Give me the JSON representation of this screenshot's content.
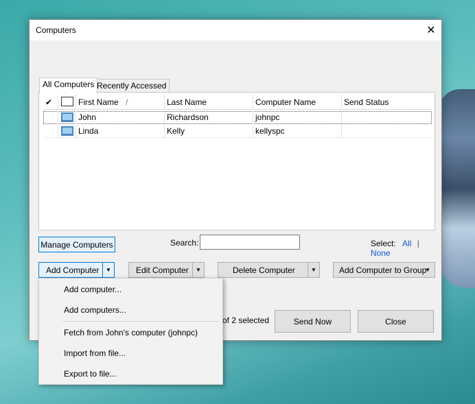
{
  "dialog": {
    "title": "Computers"
  },
  "tabs": [
    {
      "label": "All Computers"
    },
    {
      "label": "Recently Accessed"
    }
  ],
  "list": {
    "columns": [
      "First Name",
      "Last Name",
      "Computer Name",
      "Send Status"
    ],
    "sort_indicator": "/",
    "rows": [
      {
        "first": "John",
        "last": "Richardson",
        "computer": "johnpc",
        "status": ""
      },
      {
        "first": "Linda",
        "last": "Kelly",
        "computer": "kellyspc",
        "status": ""
      }
    ]
  },
  "buttons": {
    "manage": "Manage Computers",
    "add": "Add Computer",
    "edit": "Edit Computer",
    "delete": "Delete Computer",
    "group": "Add Computer to Group",
    "send": "Send Now",
    "close": "Close"
  },
  "search": {
    "label": "Search:",
    "value": ""
  },
  "select": {
    "label": "Select:",
    "all": "All",
    "sep": "|",
    "none": "None"
  },
  "status_text": "of 2 selected",
  "menu": {
    "items": [
      "Add computer...",
      "Add computers...",
      "Fetch from John's computer (johnpc)",
      "Import from file...",
      "Export to file..."
    ]
  },
  "icons": {
    "check": "checkmark-icon",
    "monitor": "monitor-icon",
    "close": "close-icon",
    "dropdown": "chevron-down-icon"
  },
  "colors": {
    "accent": "#0078d7",
    "link": "#0d55d8",
    "selection_border": "#0078d7"
  }
}
